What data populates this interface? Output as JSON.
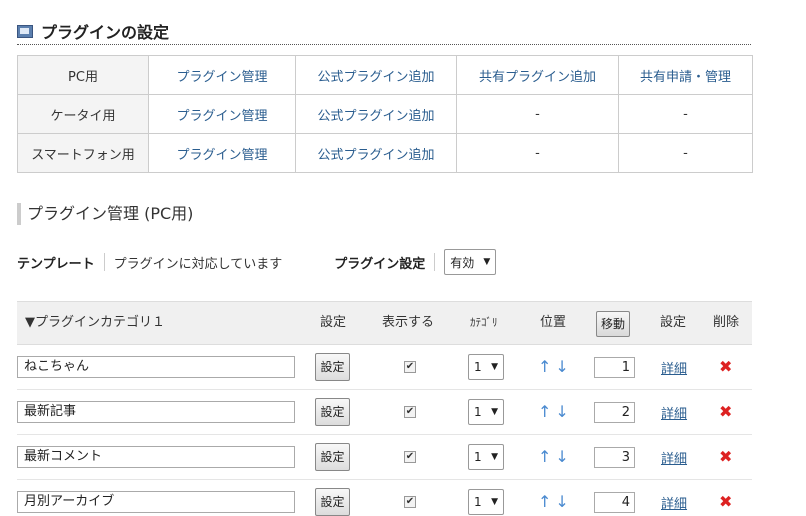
{
  "page": {
    "title": "プラグインの設定",
    "icon": "window-icon"
  },
  "device_table": [
    {
      "label": "PC用",
      "links": [
        "プラグイン管理",
        "公式プラグイン追加",
        "共有プラグイン追加",
        "共有申請・管理"
      ]
    },
    {
      "label": "ケータイ用",
      "links": [
        "プラグイン管理",
        "公式プラグイン追加",
        "-",
        "-"
      ]
    },
    {
      "label": "スマートフォン用",
      "links": [
        "プラグイン管理",
        "公式プラグイン追加",
        "-",
        "-"
      ]
    }
  ],
  "section": {
    "title": "プラグイン管理 (PC用)"
  },
  "template_row": {
    "template_label": "テンプレート",
    "template_status": "プラグインに対応しています",
    "plugin_setting_label": "プラグイン設定",
    "plugin_setting_value": "有効"
  },
  "plugin_table": {
    "category_title": "▼プラグインカテゴリ１",
    "headers": {
      "settings": "設定",
      "show": "表示する",
      "category": "ｶﾃｺﾞﾘ",
      "position": "位置",
      "move": "移動",
      "settings2": "設定",
      "delete": "削除"
    },
    "rows": [
      {
        "name": "ねこちゃん",
        "settings_label": "設定",
        "visible": true,
        "category": "1",
        "position": "1",
        "detail": "詳細"
      },
      {
        "name": "最新記事",
        "settings_label": "設定",
        "visible": true,
        "category": "1",
        "position": "2",
        "detail": "詳細"
      },
      {
        "name": "最新コメント",
        "settings_label": "設定",
        "visible": true,
        "category": "1",
        "position": "3",
        "detail": "詳細"
      },
      {
        "name": "月別アーカイブ",
        "settings_label": "設定",
        "visible": true,
        "category": "1",
        "position": "4",
        "detail": "詳細"
      }
    ],
    "arrow_up": "↑",
    "arrow_down": "↓",
    "delete_glyph": "✖",
    "check_glyph": "✔"
  },
  "colors": {
    "link": "#2a5d8f",
    "arrow": "#4a8ad0",
    "delete": "#dd2222"
  }
}
